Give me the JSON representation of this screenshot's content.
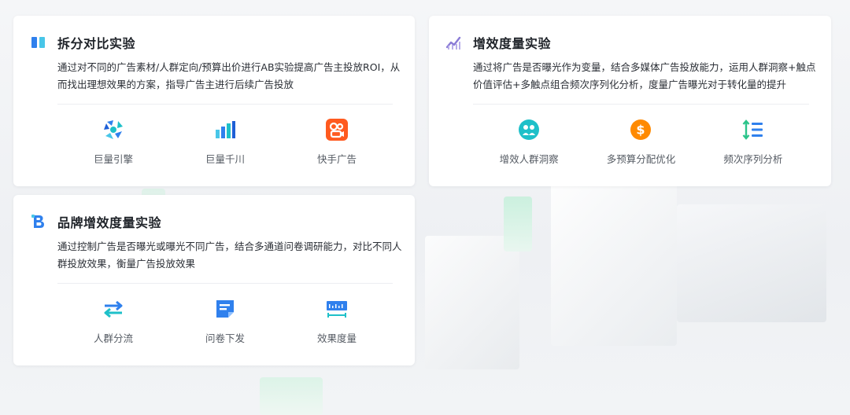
{
  "cards": [
    {
      "title": "拆分对比实验",
      "desc": "通过对不同的广告素材/人群定向/预算出价进行AB实验提高广告主投放ROI，从而找出理想效果的方案，指导广告主进行后续广告投放",
      "features": [
        {
          "label": "巨量引擎",
          "icon": "ocean-engine-logo-icon"
        },
        {
          "label": "巨量千川",
          "icon": "qianchuan-logo-icon"
        },
        {
          "label": "快手广告",
          "icon": "kuaishou-logo-icon"
        }
      ]
    },
    {
      "title": "增效度量实验",
      "desc": "通过将广告是否曝光作为变量，结合多媒体广告投放能力，运用人群洞察+触点价值评估+多触点组合频次序列化分析，度量广告曝光对于转化量的提升",
      "features": [
        {
          "label": "增效人群洞察",
          "icon": "audience-insight-icon"
        },
        {
          "label": "多预算分配优化",
          "icon": "dollar-coin-icon"
        },
        {
          "label": "频次序列分析",
          "icon": "sequence-list-icon"
        }
      ]
    },
    {
      "title": "品牌增效度量实验",
      "desc": "通过控制广告是否曝光或曝光不同广告，结合多通道问卷调研能力，对比不同人群投放效果，衡量广告投放效果",
      "features": [
        {
          "label": "人群分流",
          "icon": "swap-arrows-icon"
        },
        {
          "label": "问卷下发",
          "icon": "questionnaire-icon"
        },
        {
          "label": "效果度量",
          "icon": "ruler-icon"
        }
      ]
    }
  ],
  "colors": {
    "blue": "#2f80ed",
    "cyan": "#1ec0c9",
    "purple": "#8a7bd6",
    "orange": "#ff8a00",
    "kuaishou": "#ff5a1f",
    "green": "#2bc48a"
  }
}
